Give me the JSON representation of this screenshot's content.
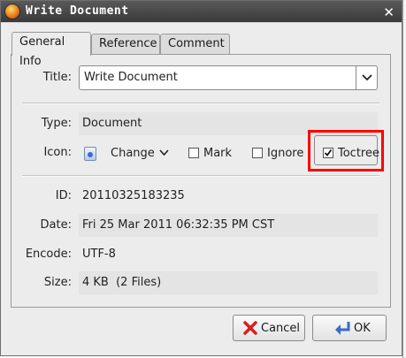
{
  "window": {
    "title": "Write Document",
    "close_glyph": "✕"
  },
  "tabs": [
    {
      "label": "General Info",
      "active": true
    },
    {
      "label": "Reference",
      "active": false
    },
    {
      "label": "Comment",
      "active": false
    }
  ],
  "fields": {
    "title_label": "Title:",
    "title_value": "Write Document",
    "type_label": "Type:",
    "type_value": "Document",
    "icon_label": "Icon:",
    "change_label": "Change",
    "mark_label": "Mark",
    "ignore_label": "Ignore",
    "toctree_label": "Toctree",
    "id_label": "ID:",
    "id_value": "20110325183235",
    "date_label": "Date:",
    "date_value": "Fri 25 Mar 2011 06:32:35 PM CST",
    "encode_label": "Encode:",
    "encode_value": "UTF-8",
    "size_label": "Size:",
    "size_value": "4 KB  (2 Files)"
  },
  "checkboxes": {
    "mark": false,
    "ignore": false,
    "toctree": true
  },
  "buttons": {
    "cancel_label": "Cancel",
    "ok_label": "OK"
  },
  "icons": {
    "app": "app-icon",
    "close": "close-icon",
    "dropdown": "chevron-down-icon",
    "doc": "document-icon",
    "cancel": "red-x-icon",
    "ok": "return-arrow-icon"
  },
  "colors": {
    "highlight": "#ff0000",
    "titlebar": "#444444",
    "dialog_bg": "#ececec"
  }
}
